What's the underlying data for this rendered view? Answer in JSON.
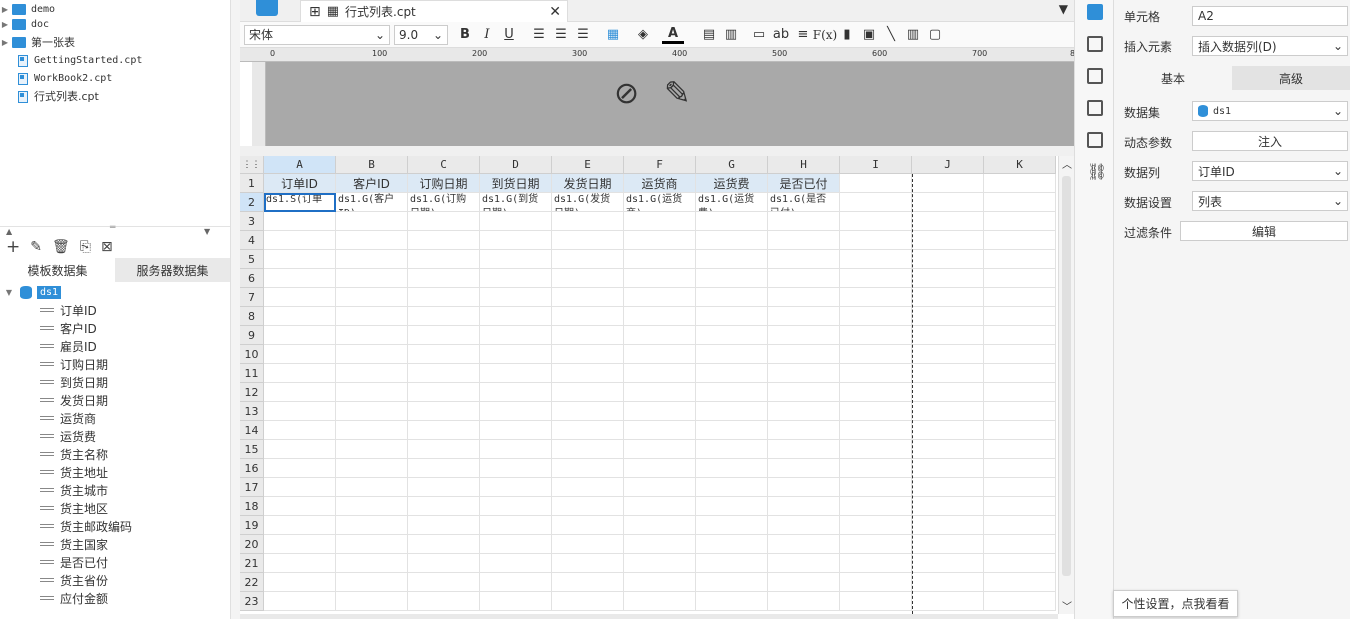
{
  "file_tree": [
    {
      "label": "demo",
      "type": "folder"
    },
    {
      "label": "doc",
      "type": "folder"
    },
    {
      "label": "第一张表",
      "type": "folder"
    },
    {
      "label": "GettingStarted.cpt",
      "type": "file"
    },
    {
      "label": "WorkBook2.cpt",
      "type": "file"
    },
    {
      "label": "行式列表.cpt",
      "type": "file"
    }
  ],
  "dataset_tabs": {
    "template": "模板数据集",
    "server": "服务器数据集"
  },
  "dataset": {
    "name": "ds1",
    "fields": [
      "订单ID",
      "客户ID",
      "雇员ID",
      "订购日期",
      "到货日期",
      "发货日期",
      "运货商",
      "运货费",
      "货主名称",
      "货主地址",
      "货主城市",
      "货主地区",
      "货主邮政编码",
      "货主国家",
      "是否已付",
      "货主省份",
      "应付金额"
    ]
  },
  "tab": {
    "title": "行式列表.cpt"
  },
  "toolbar": {
    "font": "宋体",
    "size": "9.0",
    "bold": "B",
    "italic": "I",
    "underline": "U",
    "text_ab": "ab",
    "fx": "F(x)"
  },
  "ruler": {
    "ticks": [
      "0",
      "100",
      "200",
      "300",
      "400",
      "500",
      "600",
      "700",
      "8"
    ]
  },
  "sheet": {
    "columns": [
      "A",
      "B",
      "C",
      "D",
      "E",
      "F",
      "G",
      "H",
      "I",
      "J",
      "K"
    ],
    "rows": [
      "1",
      "2",
      "3",
      "4",
      "5",
      "6",
      "7",
      "8",
      "9",
      "10",
      "11",
      "12",
      "13",
      "14",
      "15",
      "16",
      "17",
      "18",
      "19",
      "20",
      "21",
      "22",
      "23"
    ],
    "header_row": [
      "订单ID",
      "客户ID",
      "订购日期",
      "到货日期",
      "发货日期",
      "运货商",
      "运货费",
      "是否已付"
    ],
    "data_row": [
      "ds1.S(订单",
      "ds1.G(客户",
      "ds1.G(订购",
      "ds1.G(到货",
      "ds1.G(发货",
      "ds1.G(运货",
      "ds1.G(运货",
      "ds1.G(是否"
    ],
    "data_row_line2": [
      "",
      "ID)",
      "日期)",
      "日期)",
      "日期)",
      "商)",
      "费)",
      "已付)"
    ]
  },
  "props": {
    "cell_label": "单元格",
    "cell_value": "A2",
    "insert_label": "插入元素",
    "insert_value": "插入数据列(D)",
    "tab_basic": "基本",
    "tab_advanced": "高级",
    "dataset_label": "数据集",
    "dataset_value": "ds1",
    "dyn_label": "动态参数",
    "dyn_button": "注入",
    "column_label": "数据列",
    "column_value": "订单ID",
    "setting_label": "数据设置",
    "setting_value": "列表",
    "filter_label": "过滤条件",
    "filter_button": "编辑"
  },
  "tooltip": "个性设置，点我看看",
  "colors": {
    "accent": "#2f8fd8",
    "header_fill": "#dce9f5",
    "selection": "#1f6fc5"
  }
}
